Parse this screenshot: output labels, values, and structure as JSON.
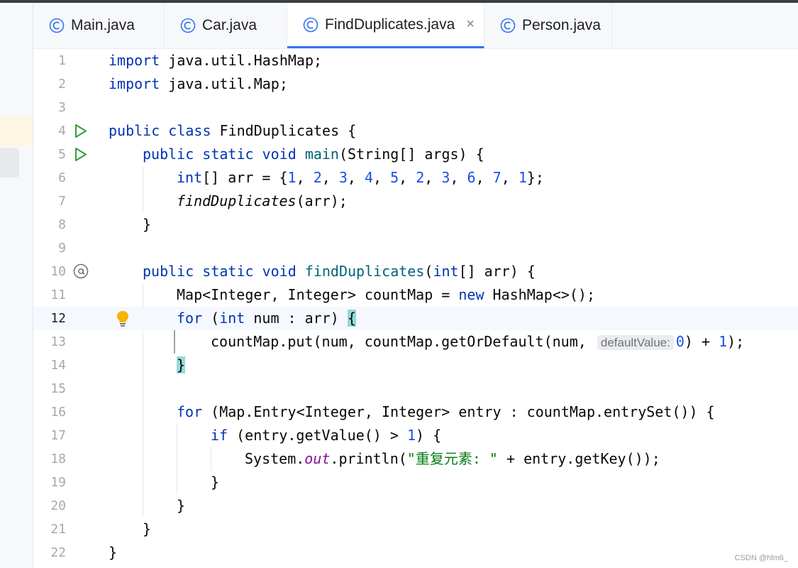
{
  "tabs": [
    {
      "label": "Main.java",
      "icon": "class-c-icon",
      "active": false
    },
    {
      "label": "Car.java",
      "icon": "class-c-icon",
      "active": false
    },
    {
      "label": "FindDuplicates.java",
      "icon": "class-c-icon",
      "active": true,
      "close": "×"
    },
    {
      "label": "Person.java",
      "icon": "class-c-icon",
      "active": false
    }
  ],
  "editor": {
    "current_line": 12,
    "line_numbers": [
      "1",
      "2",
      "3",
      "4",
      "5",
      "6",
      "7",
      "8",
      "9",
      "10",
      "11",
      "12",
      "13",
      "14",
      "15",
      "16",
      "17",
      "18",
      "19",
      "20",
      "21",
      "22"
    ],
    "gutter_icons": {
      "line4": "run-icon",
      "line5": "run-icon",
      "line10": "at-annotation-icon",
      "line12": "lightbulb-icon"
    }
  },
  "code": {
    "l1": [
      "import",
      " java.util.HashMap;"
    ],
    "l2": [
      "import",
      " java.util.Map;"
    ],
    "l4": [
      "public",
      " ",
      "class",
      " FindDuplicates {"
    ],
    "l5": [
      "public",
      " ",
      "static",
      " ",
      "void",
      " ",
      "main",
      "(String[] args) {"
    ],
    "l6": [
      "int",
      "[] arr = {",
      "1",
      ", ",
      "2",
      ", ",
      "3",
      ", ",
      "4",
      ", ",
      "5",
      ", ",
      "2",
      ", ",
      "3",
      ", ",
      "6",
      ", ",
      "7",
      ", ",
      "1",
      "};"
    ],
    "l7": [
      "findDuplicates",
      "(arr);"
    ],
    "l8": [
      "}"
    ],
    "l10": [
      "public",
      " ",
      "static",
      " ",
      "void",
      " ",
      "findDuplicates",
      "(",
      "int",
      "[] arr) {"
    ],
    "l11": [
      "Map<Integer, Integer> countMap = ",
      "new",
      " HashMap<>();"
    ],
    "l12": [
      "for",
      " (",
      "int",
      " num : arr) ",
      "{"
    ],
    "l13": [
      "countMap.put(num, countMap.getOrDefault(num, ",
      "defaultValue:",
      "0",
      ") + ",
      "1",
      ");"
    ],
    "l14": [
      "}"
    ],
    "l16": [
      "for",
      " (Map.Entry<Integer, Integer> entry : countMap.entrySet()) {"
    ],
    "l17": [
      "if",
      " (entry.getValue() > ",
      "1",
      ") {"
    ],
    "l18": [
      "System.",
      "out",
      ".println(",
      "\"重复元素: \"",
      " + entry.getKey());"
    ],
    "l19": [
      "}"
    ],
    "l20": [
      "}"
    ],
    "l21": [
      "}"
    ],
    "l22": [
      "}"
    ]
  },
  "watermark": "CSDN @hlm6_",
  "colors": {
    "keyword": "#0033b3",
    "method": "#00627a",
    "number": "#1750eb",
    "string": "#067d17",
    "field": "#871094",
    "accent": "#3574f0",
    "run": "#3a9a3a"
  }
}
